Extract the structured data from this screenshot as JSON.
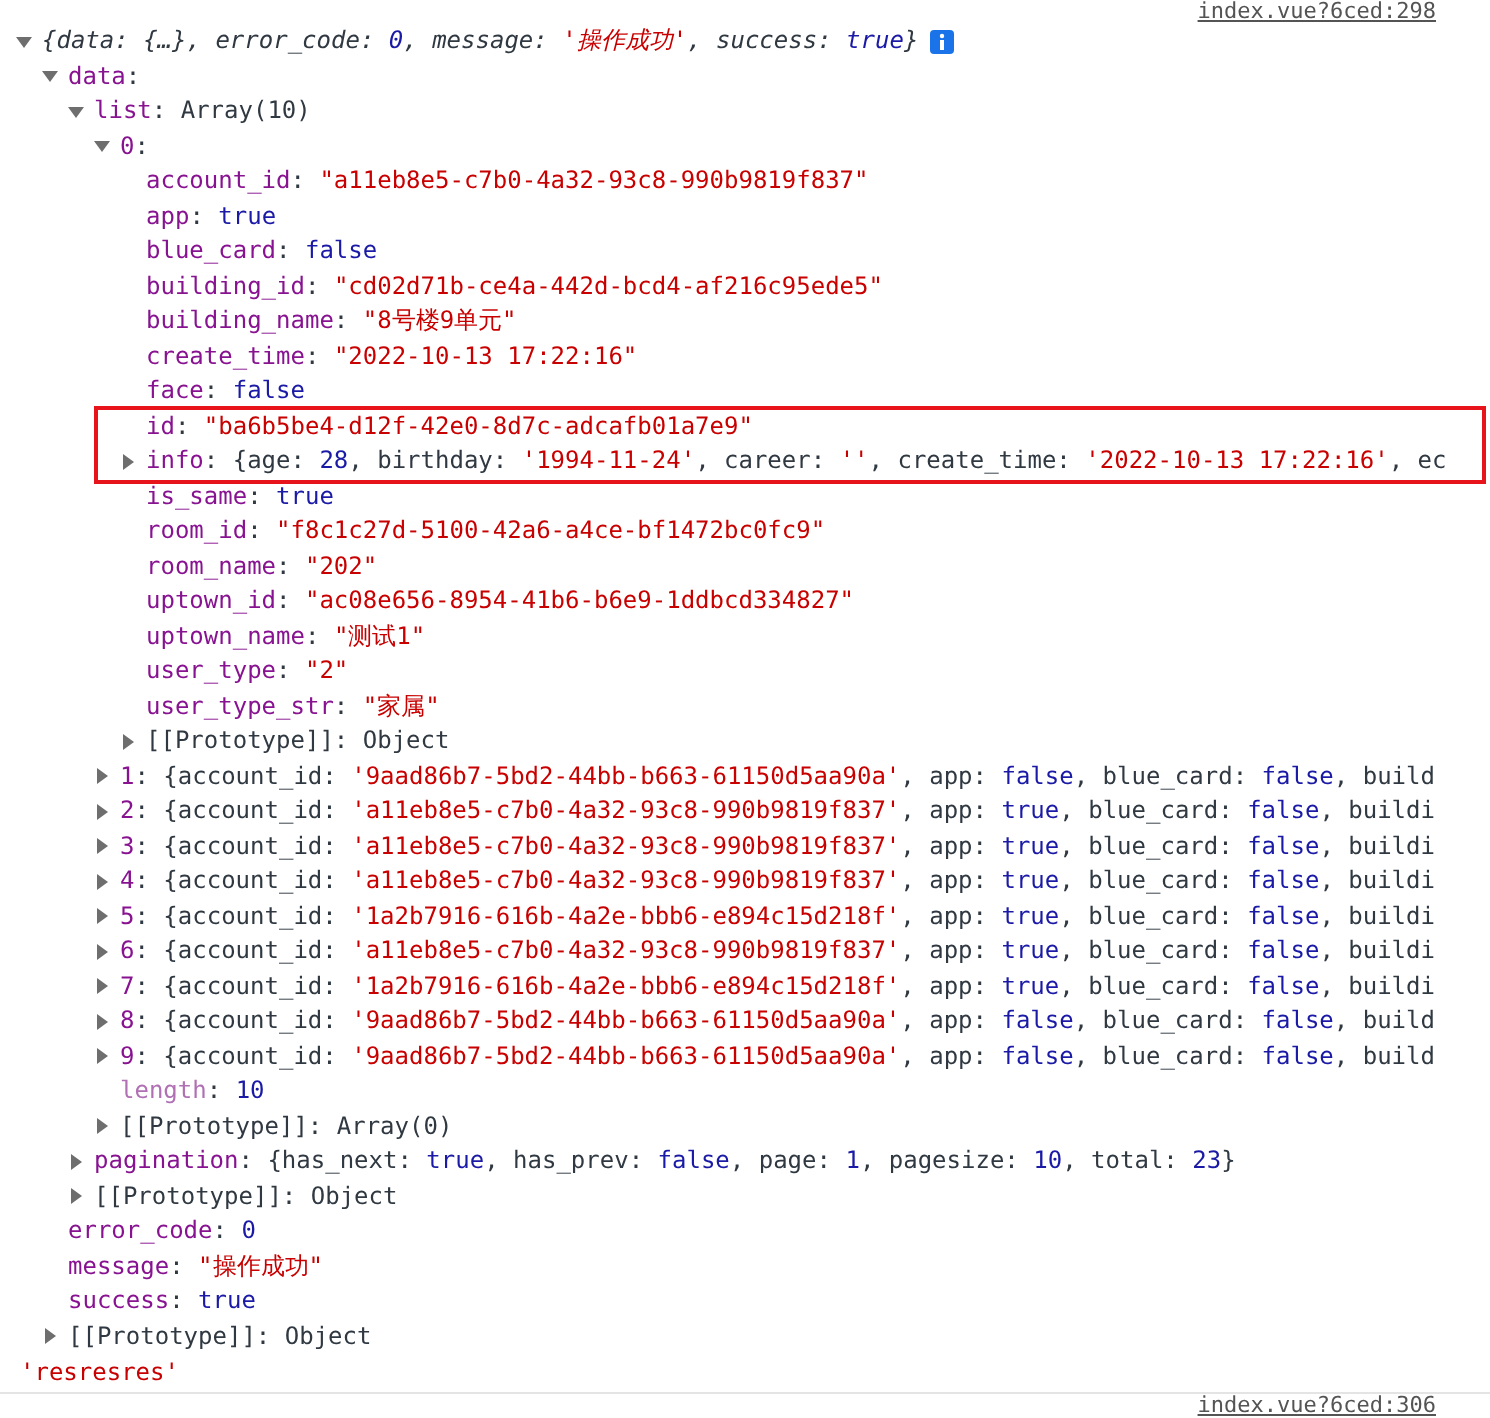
{
  "console": {
    "top_source": "index.vue?6ced:298",
    "tree": [
      {
        "kind": "summary",
        "expanded": true,
        "segments": [
          {
            "kind": "text",
            "text": "{data: {…}, error_code: "
          },
          {
            "kind": "literal",
            "text": "0"
          },
          {
            "kind": "text",
            "text": ", message: "
          },
          {
            "kind": "string",
            "text": "'操作成功'"
          },
          {
            "kind": "text",
            "text": ", success: "
          },
          {
            "kind": "literal",
            "text": "true"
          },
          {
            "kind": "text",
            "text": "}"
          }
        ],
        "children": [
          {
            "kind": "property",
            "expanded": true,
            "segments": [
              {
                "kind": "key",
                "text": "data"
              },
              {
                "kind": "text",
                "text": ":"
              }
            ],
            "children": [
              {
                "kind": "property",
                "expanded": true,
                "segments": [
                  {
                    "kind": "key",
                    "text": "list"
                  },
                  {
                    "kind": "text",
                    "text": ": Array(10)"
                  }
                ],
                "children": [
                  {
                    "kind": "property",
                    "expanded": true,
                    "segments": [
                      {
                        "kind": "key",
                        "text": "0"
                      },
                      {
                        "kind": "text",
                        "text": ":"
                      }
                    ],
                    "children": [
                      {
                        "kind": "property",
                        "segments": [
                          {
                            "kind": "key",
                            "text": "account_id"
                          },
                          {
                            "kind": "text",
                            "text": ": "
                          },
                          {
                            "kind": "string",
                            "text": "\"a11eb8e5-c7b0-4a32-93c8-990b9819f837\""
                          }
                        ]
                      },
                      {
                        "kind": "property",
                        "segments": [
                          {
                            "kind": "key",
                            "text": "app"
                          },
                          {
                            "kind": "text",
                            "text": ": "
                          },
                          {
                            "kind": "literal",
                            "text": "true"
                          }
                        ]
                      },
                      {
                        "kind": "property",
                        "segments": [
                          {
                            "kind": "key",
                            "text": "blue_card"
                          },
                          {
                            "kind": "text",
                            "text": ": "
                          },
                          {
                            "kind": "literal",
                            "text": "false"
                          }
                        ]
                      },
                      {
                        "kind": "property",
                        "segments": [
                          {
                            "kind": "key",
                            "text": "building_id"
                          },
                          {
                            "kind": "text",
                            "text": ": "
                          },
                          {
                            "kind": "string",
                            "text": "\"cd02d71b-ce4a-442d-bcd4-af216c95ede5\""
                          }
                        ]
                      },
                      {
                        "kind": "property",
                        "segments": [
                          {
                            "kind": "key",
                            "text": "building_name"
                          },
                          {
                            "kind": "text",
                            "text": ": "
                          },
                          {
                            "kind": "string",
                            "text": "\"8号楼9单元\""
                          }
                        ]
                      },
                      {
                        "kind": "property",
                        "segments": [
                          {
                            "kind": "key",
                            "text": "create_time"
                          },
                          {
                            "kind": "text",
                            "text": ": "
                          },
                          {
                            "kind": "string",
                            "text": "\"2022-10-13 17:22:16\""
                          }
                        ]
                      },
                      {
                        "kind": "property",
                        "segments": [
                          {
                            "kind": "key",
                            "text": "face"
                          },
                          {
                            "kind": "text",
                            "text": ": "
                          },
                          {
                            "kind": "literal",
                            "text": "false"
                          }
                        ]
                      },
                      {
                        "kind": "property",
                        "highlighted": true,
                        "segments": [
                          {
                            "kind": "key",
                            "text": "id"
                          },
                          {
                            "kind": "text",
                            "text": ": "
                          },
                          {
                            "kind": "string",
                            "text": "\"ba6b5be4-d12f-42e0-8d7c-adcafb01a7e9\""
                          }
                        ]
                      },
                      {
                        "kind": "property",
                        "highlighted": true,
                        "expanded": false,
                        "segments": [
                          {
                            "kind": "key",
                            "text": "info"
                          },
                          {
                            "kind": "text",
                            "text": ": {age: "
                          },
                          {
                            "kind": "literal",
                            "text": "28"
                          },
                          {
                            "kind": "text",
                            "text": ", birthday: "
                          },
                          {
                            "kind": "string",
                            "text": "'1994-11-24'"
                          },
                          {
                            "kind": "text",
                            "text": ", career: "
                          },
                          {
                            "kind": "string",
                            "text": "''"
                          },
                          {
                            "kind": "text",
                            "text": ", create_time: "
                          },
                          {
                            "kind": "string",
                            "text": "'2022-10-13 17:22:16'"
                          },
                          {
                            "kind": "text",
                            "text": ", ec"
                          }
                        ]
                      },
                      {
                        "kind": "property",
                        "segments": [
                          {
                            "kind": "key",
                            "text": "is_same"
                          },
                          {
                            "kind": "text",
                            "text": ": "
                          },
                          {
                            "kind": "literal",
                            "text": "true"
                          }
                        ]
                      },
                      {
                        "kind": "property",
                        "segments": [
                          {
                            "kind": "key",
                            "text": "room_id"
                          },
                          {
                            "kind": "text",
                            "text": ": "
                          },
                          {
                            "kind": "string",
                            "text": "\"f8c1c27d-5100-42a6-a4ce-bf1472bc0fc9\""
                          }
                        ]
                      },
                      {
                        "kind": "property",
                        "segments": [
                          {
                            "kind": "key",
                            "text": "room_name"
                          },
                          {
                            "kind": "text",
                            "text": ": "
                          },
                          {
                            "kind": "string",
                            "text": "\"202\""
                          }
                        ]
                      },
                      {
                        "kind": "property",
                        "segments": [
                          {
                            "kind": "key",
                            "text": "uptown_id"
                          },
                          {
                            "kind": "text",
                            "text": ": "
                          },
                          {
                            "kind": "string",
                            "text": "\"ac08e656-8954-41b6-b6e9-1ddbcd334827\""
                          }
                        ]
                      },
                      {
                        "kind": "property",
                        "segments": [
                          {
                            "kind": "key",
                            "text": "uptown_name"
                          },
                          {
                            "kind": "text",
                            "text": ": "
                          },
                          {
                            "kind": "string",
                            "text": "\"测试1\""
                          }
                        ]
                      },
                      {
                        "kind": "property",
                        "segments": [
                          {
                            "kind": "key",
                            "text": "user_type"
                          },
                          {
                            "kind": "text",
                            "text": ": "
                          },
                          {
                            "kind": "string",
                            "text": "\"2\""
                          }
                        ]
                      },
                      {
                        "kind": "property",
                        "segments": [
                          {
                            "kind": "key",
                            "text": "user_type_str"
                          },
                          {
                            "kind": "text",
                            "text": ": "
                          },
                          {
                            "kind": "string",
                            "text": "\"家属\""
                          }
                        ]
                      },
                      {
                        "kind": "property",
                        "expanded": false,
                        "segments": [
                          {
                            "kind": "text",
                            "text": "[[Prototype]]: Object"
                          }
                        ]
                      }
                    ]
                  },
                  {
                    "kind": "property",
                    "expanded": false,
                    "segments": [
                      {
                        "kind": "key",
                        "text": "1"
                      },
                      {
                        "kind": "text",
                        "text": ": {account_id: "
                      },
                      {
                        "kind": "string",
                        "text": "'9aad86b7-5bd2-44bb-b663-61150d5aa90a'"
                      },
                      {
                        "kind": "text",
                        "text": ", app: "
                      },
                      {
                        "kind": "literal",
                        "text": "false"
                      },
                      {
                        "kind": "text",
                        "text": ", blue_card: "
                      },
                      {
                        "kind": "literal",
                        "text": "false"
                      },
                      {
                        "kind": "text",
                        "text": ", build"
                      }
                    ]
                  },
                  {
                    "kind": "property",
                    "expanded": false,
                    "segments": [
                      {
                        "kind": "key",
                        "text": "2"
                      },
                      {
                        "kind": "text",
                        "text": ": {account_id: "
                      },
                      {
                        "kind": "string",
                        "text": "'a11eb8e5-c7b0-4a32-93c8-990b9819f837'"
                      },
                      {
                        "kind": "text",
                        "text": ", app: "
                      },
                      {
                        "kind": "literal",
                        "text": "true"
                      },
                      {
                        "kind": "text",
                        "text": ", blue_card: "
                      },
                      {
                        "kind": "literal",
                        "text": "false"
                      },
                      {
                        "kind": "text",
                        "text": ", buildi"
                      }
                    ]
                  },
                  {
                    "kind": "property",
                    "expanded": false,
                    "segments": [
                      {
                        "kind": "key",
                        "text": "3"
                      },
                      {
                        "kind": "text",
                        "text": ": {account_id: "
                      },
                      {
                        "kind": "string",
                        "text": "'a11eb8e5-c7b0-4a32-93c8-990b9819f837'"
                      },
                      {
                        "kind": "text",
                        "text": ", app: "
                      },
                      {
                        "kind": "literal",
                        "text": "true"
                      },
                      {
                        "kind": "text",
                        "text": ", blue_card: "
                      },
                      {
                        "kind": "literal",
                        "text": "false"
                      },
                      {
                        "kind": "text",
                        "text": ", buildi"
                      }
                    ]
                  },
                  {
                    "kind": "property",
                    "expanded": false,
                    "segments": [
                      {
                        "kind": "key",
                        "text": "4"
                      },
                      {
                        "kind": "text",
                        "text": ": {account_id: "
                      },
                      {
                        "kind": "string",
                        "text": "'a11eb8e5-c7b0-4a32-93c8-990b9819f837'"
                      },
                      {
                        "kind": "text",
                        "text": ", app: "
                      },
                      {
                        "kind": "literal",
                        "text": "true"
                      },
                      {
                        "kind": "text",
                        "text": ", blue_card: "
                      },
                      {
                        "kind": "literal",
                        "text": "false"
                      },
                      {
                        "kind": "text",
                        "text": ", buildi"
                      }
                    ]
                  },
                  {
                    "kind": "property",
                    "expanded": false,
                    "segments": [
                      {
                        "kind": "key",
                        "text": "5"
                      },
                      {
                        "kind": "text",
                        "text": ": {account_id: "
                      },
                      {
                        "kind": "string",
                        "text": "'1a2b7916-616b-4a2e-bbb6-e894c15d218f'"
                      },
                      {
                        "kind": "text",
                        "text": ", app: "
                      },
                      {
                        "kind": "literal",
                        "text": "true"
                      },
                      {
                        "kind": "text",
                        "text": ", blue_card: "
                      },
                      {
                        "kind": "literal",
                        "text": "false"
                      },
                      {
                        "kind": "text",
                        "text": ", buildi"
                      }
                    ]
                  },
                  {
                    "kind": "property",
                    "expanded": false,
                    "segments": [
                      {
                        "kind": "key",
                        "text": "6"
                      },
                      {
                        "kind": "text",
                        "text": ": {account_id: "
                      },
                      {
                        "kind": "string",
                        "text": "'a11eb8e5-c7b0-4a32-93c8-990b9819f837'"
                      },
                      {
                        "kind": "text",
                        "text": ", app: "
                      },
                      {
                        "kind": "literal",
                        "text": "true"
                      },
                      {
                        "kind": "text",
                        "text": ", blue_card: "
                      },
                      {
                        "kind": "literal",
                        "text": "false"
                      },
                      {
                        "kind": "text",
                        "text": ", buildi"
                      }
                    ]
                  },
                  {
                    "kind": "property",
                    "expanded": false,
                    "segments": [
                      {
                        "kind": "key",
                        "text": "7"
                      },
                      {
                        "kind": "text",
                        "text": ": {account_id: "
                      },
                      {
                        "kind": "string",
                        "text": "'1a2b7916-616b-4a2e-bbb6-e894c15d218f'"
                      },
                      {
                        "kind": "text",
                        "text": ", app: "
                      },
                      {
                        "kind": "literal",
                        "text": "true"
                      },
                      {
                        "kind": "text",
                        "text": ", blue_card: "
                      },
                      {
                        "kind": "literal",
                        "text": "false"
                      },
                      {
                        "kind": "text",
                        "text": ", buildi"
                      }
                    ]
                  },
                  {
                    "kind": "property",
                    "expanded": false,
                    "segments": [
                      {
                        "kind": "key",
                        "text": "8"
                      },
                      {
                        "kind": "text",
                        "text": ": {account_id: "
                      },
                      {
                        "kind": "string",
                        "text": "'9aad86b7-5bd2-44bb-b663-61150d5aa90a'"
                      },
                      {
                        "kind": "text",
                        "text": ", app: "
                      },
                      {
                        "kind": "literal",
                        "text": "false"
                      },
                      {
                        "kind": "text",
                        "text": ", blue_card: "
                      },
                      {
                        "kind": "literal",
                        "text": "false"
                      },
                      {
                        "kind": "text",
                        "text": ", build"
                      }
                    ]
                  },
                  {
                    "kind": "property",
                    "expanded": false,
                    "segments": [
                      {
                        "kind": "key",
                        "text": "9"
                      },
                      {
                        "kind": "text",
                        "text": ": {account_id: "
                      },
                      {
                        "kind": "string",
                        "text": "'9aad86b7-5bd2-44bb-b663-61150d5aa90a'"
                      },
                      {
                        "kind": "text",
                        "text": ", app: "
                      },
                      {
                        "kind": "literal",
                        "text": "false"
                      },
                      {
                        "kind": "text",
                        "text": ", blue_card: "
                      },
                      {
                        "kind": "literal",
                        "text": "false"
                      },
                      {
                        "kind": "text",
                        "text": ", build"
                      }
                    ]
                  },
                  {
                    "kind": "property",
                    "segments": [
                      {
                        "kind": "dimkey",
                        "text": "length"
                      },
                      {
                        "kind": "text",
                        "text": ": "
                      },
                      {
                        "kind": "literal",
                        "text": "10"
                      }
                    ]
                  },
                  {
                    "kind": "property",
                    "expanded": false,
                    "segments": [
                      {
                        "kind": "text",
                        "text": "[[Prototype]]: Array(0)"
                      }
                    ]
                  }
                ]
              },
              {
                "kind": "property",
                "expanded": false,
                "segments": [
                  {
                    "kind": "key",
                    "text": "pagination"
                  },
                  {
                    "kind": "text",
                    "text": ": {has_next: "
                  },
                  {
                    "kind": "literal",
                    "text": "true"
                  },
                  {
                    "kind": "text",
                    "text": ", has_prev: "
                  },
                  {
                    "kind": "literal",
                    "text": "false"
                  },
                  {
                    "kind": "text",
                    "text": ", page: "
                  },
                  {
                    "kind": "literal",
                    "text": "1"
                  },
                  {
                    "kind": "text",
                    "text": ", pagesize: "
                  },
                  {
                    "kind": "literal",
                    "text": "10"
                  },
                  {
                    "kind": "text",
                    "text": ", total: "
                  },
                  {
                    "kind": "literal",
                    "text": "23"
                  },
                  {
                    "kind": "text",
                    "text": "}"
                  }
                ]
              },
              {
                "kind": "property",
                "expanded": false,
                "segments": [
                  {
                    "kind": "text",
                    "text": "[[Prototype]]: Object"
                  }
                ]
              }
            ]
          },
          {
            "kind": "property",
            "segments": [
              {
                "kind": "key",
                "text": "error_code"
              },
              {
                "kind": "text",
                "text": ": "
              },
              {
                "kind": "literal",
                "text": "0"
              }
            ]
          },
          {
            "kind": "property",
            "segments": [
              {
                "kind": "key",
                "text": "message"
              },
              {
                "kind": "text",
                "text": ": "
              },
              {
                "kind": "string",
                "text": "\"操作成功\""
              }
            ]
          },
          {
            "kind": "property",
            "segments": [
              {
                "kind": "key",
                "text": "success"
              },
              {
                "kind": "text",
                "text": ": "
              },
              {
                "kind": "literal",
                "text": "true"
              }
            ]
          },
          {
            "kind": "property",
            "expanded": false,
            "segments": [
              {
                "kind": "text",
                "text": "[[Prototype]]: Object"
              }
            ]
          }
        ]
      }
    ],
    "string_log": "'resresres'",
    "next_source": "index.vue?6ced:306"
  }
}
